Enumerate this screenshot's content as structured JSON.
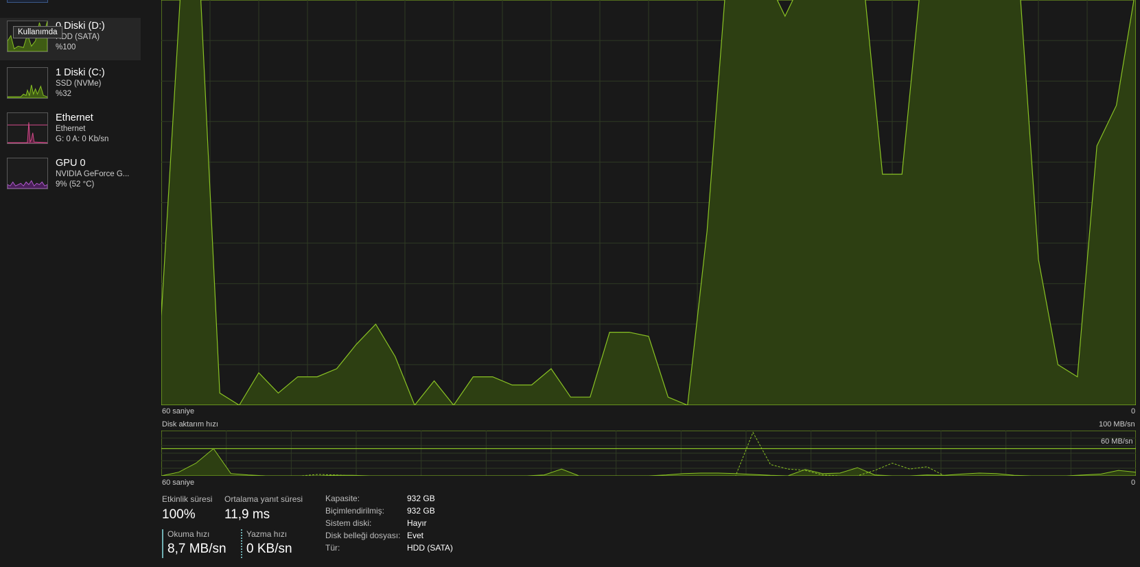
{
  "colors": {
    "accent": "#8ac324",
    "ethernet": "#d44b8a",
    "gpu": "#b15ad0",
    "background": "#191919"
  },
  "sidebar": {
    "tooltip": "Kullanımda",
    "items": [
      {
        "title": "0 Diski (D:)",
        "line1": "HDD (SATA)",
        "line2": "%100",
        "icon": "disk-graph",
        "selected": true
      },
      {
        "title": "1 Diski (C:)",
        "line1": "SSD (NVMe)",
        "line2": "%32",
        "icon": "disk-graph"
      },
      {
        "title": "Ethernet",
        "line1": "Ethernet",
        "line2": "G: 0 A: 0 Kb/sn",
        "icon": "ethernet-graph"
      },
      {
        "title": "GPU 0",
        "line1": "NVIDIA GeForce G...",
        "line2": "9%  (52 °C)",
        "icon": "gpu-graph"
      }
    ]
  },
  "main_chart": {
    "x_left_label": "60 saniye",
    "x_right_label": "0",
    "values": [
      22,
      103,
      103,
      3,
      0,
      8,
      3,
      7,
      7,
      9,
      15,
      20,
      12,
      0,
      6,
      0,
      7,
      7,
      5,
      5,
      9,
      2,
      2,
      18,
      18,
      17,
      2,
      0,
      43,
      106,
      106,
      106,
      96,
      106,
      106,
      106,
      106,
      57,
      57,
      106,
      106,
      106,
      106,
      106,
      106,
      36,
      10,
      7,
      64,
      74,
      103
    ]
  },
  "transfer_chart": {
    "title": "Disk aktarım hızı",
    "max_label": "100 MB/sn",
    "line_label": "60 MB/sn",
    "line_value": 60,
    "x_left_label": "60 saniye",
    "x_right_label": "0",
    "read_values": [
      0,
      8,
      28,
      60,
      5,
      2,
      0,
      0,
      0,
      0,
      1,
      1,
      0,
      0,
      0,
      0,
      0,
      0,
      0,
      0,
      0,
      0,
      2,
      15,
      0,
      0,
      0,
      0,
      0,
      2,
      5,
      6,
      6,
      5,
      3,
      1,
      0,
      14,
      5,
      6,
      18,
      2,
      0,
      0,
      2,
      1,
      4,
      6,
      5,
      1,
      0,
      0,
      0,
      2,
      4,
      12,
      8
    ],
    "write_values": [
      0,
      0,
      0,
      0,
      0,
      0,
      0,
      0,
      0,
      3,
      2,
      0,
      0,
      0,
      0,
      0,
      0,
      0,
      0,
      0,
      0,
      0,
      0,
      0,
      0,
      0,
      0,
      0,
      0,
      0,
      0,
      0,
      0,
      0,
      96,
      25,
      15,
      12,
      2,
      0,
      0,
      12,
      28,
      15,
      20,
      0,
      0,
      0,
      0,
      0,
      0,
      0,
      0,
      0,
      0,
      0,
      0
    ]
  },
  "stats": {
    "active_time_label": "Etkinlik süresi",
    "active_time_value": "100%",
    "avg_response_label": "Ortalama yanıt süresi",
    "avg_response_value": "11,9 ms",
    "read_label": "Okuma hızı",
    "read_value": "8,7 MB/sn",
    "write_label": "Yazma hızı",
    "write_value": "0 KB/sn"
  },
  "properties": [
    {
      "label": "Kapasite:",
      "value": "932 GB"
    },
    {
      "label": "Biçimlendirilmiş:",
      "value": "932 GB"
    },
    {
      "label": "Sistem diski:",
      "value": "Hayır"
    },
    {
      "label": "Disk belleği dosyası:",
      "value": "Evet"
    },
    {
      "label": "Tür:",
      "value": "HDD (SATA)"
    }
  ]
}
